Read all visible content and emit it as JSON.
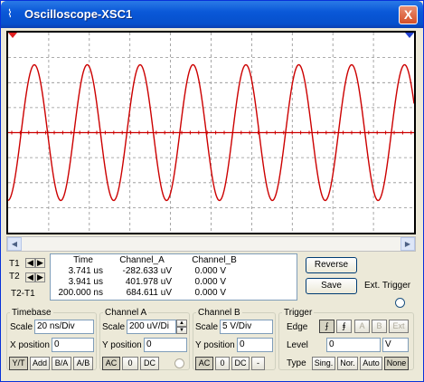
{
  "window": {
    "title": "Oscilloscope-XSC1",
    "close_label": "X"
  },
  "trace": {
    "color": "#cc0000",
    "grid_color": "#909090"
  },
  "cursors": {
    "t1": "T1",
    "t2": "T2",
    "t2t1": "T2-T1"
  },
  "readout": {
    "headers": [
      "Time",
      "Channel_A",
      "Channel_B"
    ],
    "rows": [
      [
        "3.741 us",
        "-282.633 uV",
        "0.000 V"
      ],
      [
        "3.941 us",
        "401.978 uV",
        "0.000 V"
      ],
      [
        "200.000 ns",
        "684.611 uV",
        "0.000 V"
      ]
    ]
  },
  "buttons": {
    "reverse": "Reverse",
    "save": "Save",
    "ext_trigger": "Ext. Trigger"
  },
  "timebase": {
    "title": "Timebase",
    "scale_label": "Scale",
    "scale_value": "20 ns/Div",
    "xpos_label": "X position",
    "xpos_value": "0",
    "modes": [
      "Y/T",
      "Add",
      "B/A",
      "A/B"
    ]
  },
  "channel_a": {
    "title": "Channel A",
    "scale_label": "Scale",
    "scale_value": "200 uV/Di",
    "ypos_label": "Y position",
    "ypos_value": "0",
    "coupling": [
      "AC",
      "0",
      "DC"
    ]
  },
  "channel_b": {
    "title": "Channel B",
    "scale_label": "Scale",
    "scale_value": "5  V/Div",
    "ypos_label": "Y position",
    "ypos_value": "0",
    "coupling": [
      "AC",
      "0",
      "DC",
      "-"
    ]
  },
  "trigger": {
    "title": "Trigger",
    "edge_label": "Edge",
    "sources": [
      "A",
      "B",
      "Ext"
    ],
    "level_label": "Level",
    "level_value": "0",
    "level_unit": "V",
    "type_label": "Type",
    "types": [
      "Sing.",
      "Nor.",
      "Auto",
      "None"
    ]
  }
}
